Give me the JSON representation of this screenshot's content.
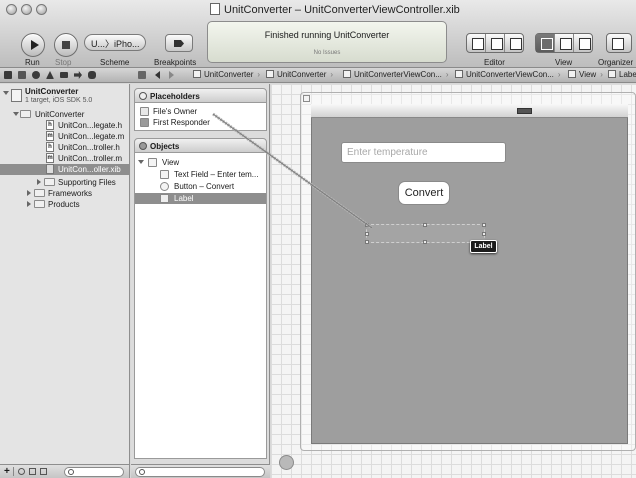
{
  "window": {
    "title": "UnitConverter – UnitConverterViewController.xib"
  },
  "toolbar": {
    "run_label": "Run",
    "stop_label": "Stop",
    "scheme_value": "U...〉iPho...",
    "scheme_label": "Scheme",
    "breakpoints_label": "Breakpoints",
    "activity_status": "Finished running UnitConverter",
    "activity_issues": "No Issues",
    "editor_label": "Editor",
    "view_label": "View",
    "organizer_label": "Organizer"
  },
  "jumpbar": {
    "crumbs": [
      "UnitConverter",
      "UnitConverter",
      "UnitConverterViewCon...",
      "UnitConverterViewCon...",
      "View",
      "Labe"
    ]
  },
  "navigator": {
    "project_name": "UnitConverter",
    "project_sub": "1 target, iOS SDK 5.0",
    "group_name": "UnitConverter",
    "files": [
      {
        "badge": "h",
        "name": "UnitCon...legate.h"
      },
      {
        "badge": "m",
        "name": "UnitCon...legate.m"
      },
      {
        "badge": "h",
        "name": "UnitCon...troller.h"
      },
      {
        "badge": "m",
        "name": "UnitCon...troller.m"
      },
      {
        "badge": "",
        "name": "UnitCon...oller.xib"
      }
    ],
    "supporting": "Supporting Files",
    "frameworks": "Frameworks",
    "products": "Products"
  },
  "outline": {
    "placeholders_title": "Placeholders",
    "files_owner": "File's Owner",
    "first_responder": "First Responder",
    "objects_title": "Objects",
    "view": "View",
    "text_field": "Text Field – Enter tem...",
    "button": "Button – Convert",
    "label": "Label"
  },
  "canvas": {
    "text_field_placeholder": "Enter temperature",
    "convert_button": "Convert",
    "label_hud": "Label"
  },
  "colors": {
    "selection": "#8e8e8e",
    "view_background": "#9e9e9e"
  }
}
